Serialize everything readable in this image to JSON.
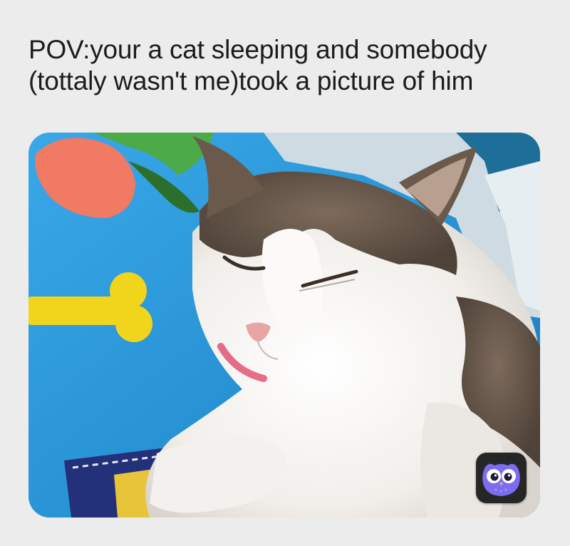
{
  "caption": {
    "text": "POV:your a cat sleeping and somebody\n(tottaly wasn't me)took a picture of him"
  },
  "photo": {
    "icon": "sleeping-cat-photo",
    "colors": {
      "blanket": "#2a95d8",
      "cat_white": "#f4f2ef",
      "cat_tabby": "#6b5a4c"
    }
  },
  "badge": {
    "icon": "owl-app-icon",
    "colors": {
      "background": "#262626",
      "owl": "#7b6cf2"
    }
  },
  "colors": {
    "page_background": "#ececec",
    "text": "#1c1c1c"
  }
}
